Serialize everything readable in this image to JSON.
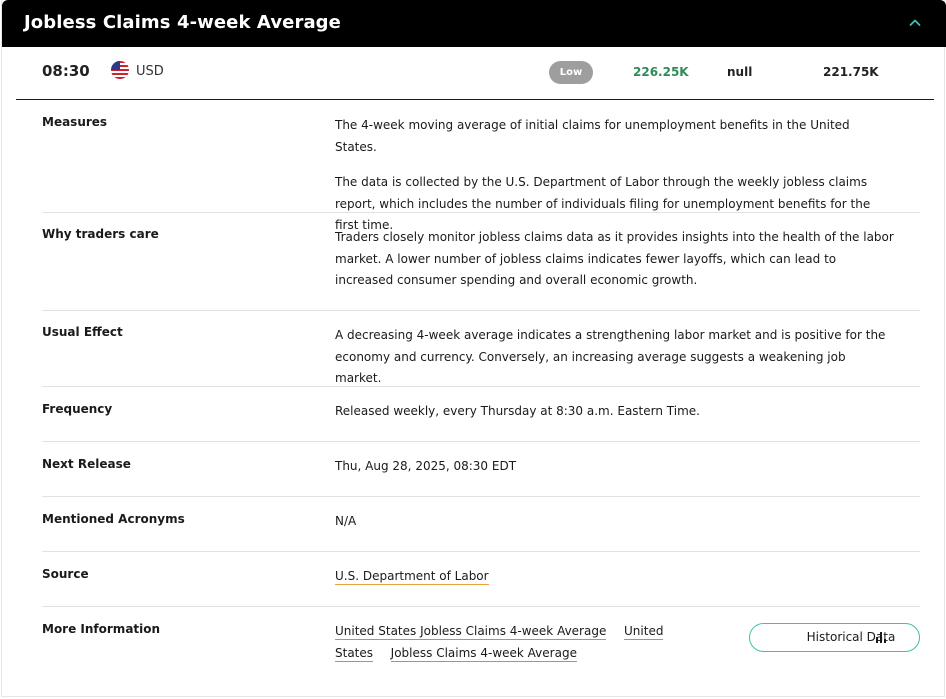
{
  "header": {
    "title": "Jobless Claims 4-week Average",
    "collapse_icon": "chevron-up-icon",
    "accent_color": "#3fbfaf"
  },
  "summary": {
    "time": "08:30",
    "currency": "USD",
    "flag_icon": "us-flag-icon",
    "impact": "Low",
    "actual": "226.25K",
    "actual_color": "#2e8b57",
    "forecast": "null",
    "previous": "221.75K"
  },
  "details": {
    "measures": {
      "label": "Measures",
      "text1": "The 4-week moving average of initial claims for unemployment benefits in the United States.",
      "text2": "The data is collected by the U.S. Department of Labor through the weekly jobless claims report, which includes the number of individuals filing for unemployment benefits for the first time."
    },
    "why": {
      "label": "Why traders care",
      "text": "Traders closely monitor jobless claims data as it provides insights into the health of the labor market. A lower number of jobless claims indicates fewer layoffs, which can lead to increased consumer spending and overall economic growth."
    },
    "effect": {
      "label": "Usual Effect",
      "text": "A decreasing 4-week average indicates a strengthening labor market and is positive for the economy and currency. Conversely, an increasing average suggests a weakening job market."
    },
    "frequency": {
      "label": "Frequency",
      "text": "Released weekly, every Thursday at 8:30 a.m. Eastern Time."
    },
    "next_release": {
      "label": "Next Release",
      "text": "Thu, Aug 28, 2025, 08:30 EDT"
    },
    "acronyms": {
      "label": "Mentioned Acronyms",
      "text": "N/A"
    },
    "source": {
      "label": "Source",
      "link": "U.S. Department of Labor"
    },
    "more_info": {
      "label": "More Information",
      "links": [
        "United States Jobless Claims 4-week Average",
        "United",
        "States",
        "Jobless Claims 4-week Average"
      ],
      "historical_button": "Historical Data",
      "historical_icon": "bar-chart-icon"
    }
  }
}
